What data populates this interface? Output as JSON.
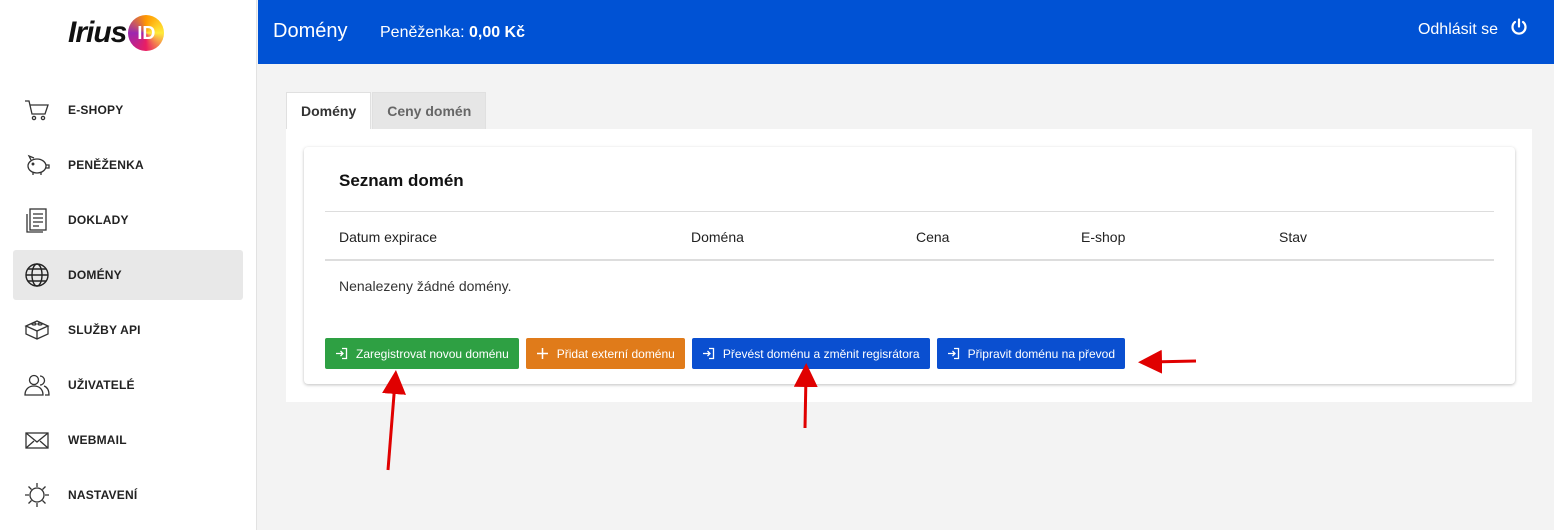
{
  "logo": {
    "text": "Irius",
    "badge": "ID"
  },
  "sidebar": {
    "items": [
      {
        "label": "E-SHOPY",
        "icon": "cart-icon"
      },
      {
        "label": "PENĚŽENKA",
        "icon": "piggy-bank-icon"
      },
      {
        "label": "DOKLADY",
        "icon": "document-icon"
      },
      {
        "label": "DOMÉNY",
        "icon": "globe-icon",
        "active": true
      },
      {
        "label": "SLUŽBY API",
        "icon": "api-blocks-icon"
      },
      {
        "label": "UŽIVATELÉ",
        "icon": "users-icon"
      },
      {
        "label": "WEBMAIL",
        "icon": "envelope-icon"
      },
      {
        "label": "NASTAVENÍ",
        "icon": "gear-icon"
      }
    ]
  },
  "header": {
    "title": "Domény",
    "wallet_label": "Peněženka:",
    "wallet_amount": "0,00 Kč",
    "logout_label": "Odhlásit se",
    "logout_icon": "power-icon",
    "background": "#0052d4"
  },
  "tabs": [
    {
      "label": "Domény",
      "active": true
    },
    {
      "label": "Ceny domén",
      "active": false
    }
  ],
  "card": {
    "title": "Seznam domén",
    "columns": [
      "Datum expirace",
      "Doména",
      "Cena",
      "E-shop",
      "Stav"
    ],
    "empty_text": "Nenalezeny žádné domény."
  },
  "buttons": {
    "register": {
      "label": "Zaregistrovat novou doménu",
      "icon": "login-arrow-icon",
      "color": "#2ea043"
    },
    "add_external": {
      "label": "Přidat externí doménu",
      "icon": "plus-icon",
      "color": "#e07b1a"
    },
    "transfer": {
      "label": "Převést doménu a změnit regisrátora",
      "icon": "login-arrow-icon",
      "color": "#0a4fd0"
    },
    "prepare": {
      "label": "Připravit doménu na převod",
      "icon": "login-arrow-icon",
      "color": "#0a4fd0"
    }
  },
  "annotation_color": "#e00000"
}
